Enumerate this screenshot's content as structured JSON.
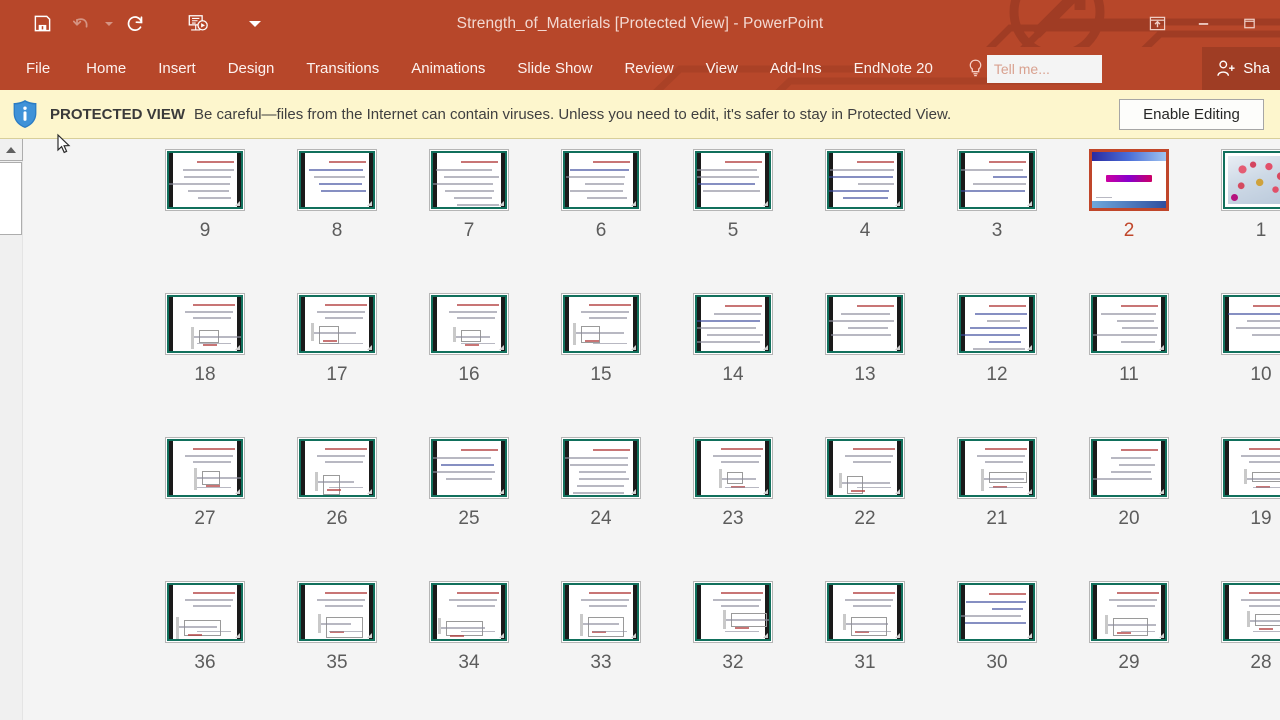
{
  "titlebar": {
    "title": "Strength_of_Materials [Protected View] - PowerPoint",
    "accent_color": "#b7472a",
    "quick_access": [
      {
        "name": "save-icon",
        "label": "Save"
      },
      {
        "name": "undo-icon",
        "label": "Undo"
      },
      {
        "name": "redo-icon",
        "label": "Repeat"
      },
      {
        "name": "start-slideshow-icon",
        "label": "Start From Beginning"
      },
      {
        "name": "customize-quick-access-toolbar-icon",
        "label": "Customize Quick Access Toolbar"
      }
    ],
    "window_controls": [
      {
        "name": "ribbon-display-options-icon",
        "label": "Ribbon Display Options"
      },
      {
        "name": "minimize-icon",
        "label": "Minimize"
      },
      {
        "name": "restore-icon",
        "label": "Restore Down"
      }
    ]
  },
  "ribbon": {
    "tabs": [
      {
        "label": "File"
      },
      {
        "label": "Home"
      },
      {
        "label": "Insert"
      },
      {
        "label": "Design"
      },
      {
        "label": "Transitions"
      },
      {
        "label": "Animations"
      },
      {
        "label": "Slide Show"
      },
      {
        "label": "Review"
      },
      {
        "label": "View"
      },
      {
        "label": "Add-Ins"
      },
      {
        "label": "EndNote 20"
      }
    ],
    "tell_me_placeholder": "Tell me...",
    "tell_me_value": "",
    "share_label": "Sha"
  },
  "protected_view": {
    "label": "PROTECTED VIEW",
    "message": "Be careful—files from the Internet can contain viruses. Unless you need to edit, it's safer to stay in Protected View.",
    "button_label": "Enable Editing",
    "background_color": "#fdf6cd"
  },
  "slide_sorter": {
    "selected_slide": 2,
    "selected_color": "#c0462a",
    "theme_border_color": "#11705c",
    "rows": [
      {
        "numbers": [
          "9",
          "8",
          "7",
          "6",
          "5",
          "4",
          "3",
          "2",
          "1"
        ]
      },
      {
        "numbers": [
          "18",
          "17",
          "16",
          "15",
          "14",
          "13",
          "12",
          "11",
          "10"
        ]
      },
      {
        "numbers": [
          "27",
          "26",
          "25",
          "24",
          "23",
          "22",
          "21",
          "20",
          "19"
        ]
      },
      {
        "numbers": [
          "36",
          "35",
          "34",
          "33",
          "32",
          "31",
          "30",
          "29",
          "28"
        ]
      }
    ],
    "slides": [
      {
        "number": "9",
        "kind": "text"
      },
      {
        "number": "8",
        "kind": "text"
      },
      {
        "number": "7",
        "kind": "text"
      },
      {
        "number": "6",
        "kind": "text"
      },
      {
        "number": "5",
        "kind": "text"
      },
      {
        "number": "4",
        "kind": "text"
      },
      {
        "number": "3",
        "kind": "text"
      },
      {
        "number": "2",
        "kind": "title"
      },
      {
        "number": "1",
        "kind": "photo"
      },
      {
        "number": "18",
        "kind": "diagram"
      },
      {
        "number": "17",
        "kind": "diagram"
      },
      {
        "number": "16",
        "kind": "diagram"
      },
      {
        "number": "15",
        "kind": "diagram"
      },
      {
        "number": "14",
        "kind": "text"
      },
      {
        "number": "13",
        "kind": "text"
      },
      {
        "number": "12",
        "kind": "text"
      },
      {
        "number": "11",
        "kind": "text"
      },
      {
        "number": "10",
        "kind": "text"
      },
      {
        "number": "27",
        "kind": "diagram"
      },
      {
        "number": "26",
        "kind": "diagram"
      },
      {
        "number": "25",
        "kind": "text"
      },
      {
        "number": "24",
        "kind": "text"
      },
      {
        "number": "23",
        "kind": "diagram"
      },
      {
        "number": "22",
        "kind": "diagram"
      },
      {
        "number": "21",
        "kind": "diagram"
      },
      {
        "number": "20",
        "kind": "text"
      },
      {
        "number": "19",
        "kind": "diagram"
      },
      {
        "number": "36",
        "kind": "diagram"
      },
      {
        "number": "35",
        "kind": "diagram"
      },
      {
        "number": "34",
        "kind": "diagram"
      },
      {
        "number": "33",
        "kind": "diagram"
      },
      {
        "number": "32",
        "kind": "diagram"
      },
      {
        "number": "31",
        "kind": "diagram"
      },
      {
        "number": "30",
        "kind": "text"
      },
      {
        "number": "29",
        "kind": "diagram"
      },
      {
        "number": "28",
        "kind": "diagram"
      }
    ]
  },
  "scrollbar": {
    "name": "vertical-scrollbar",
    "up_arrow": "scroll-up-arrow"
  }
}
